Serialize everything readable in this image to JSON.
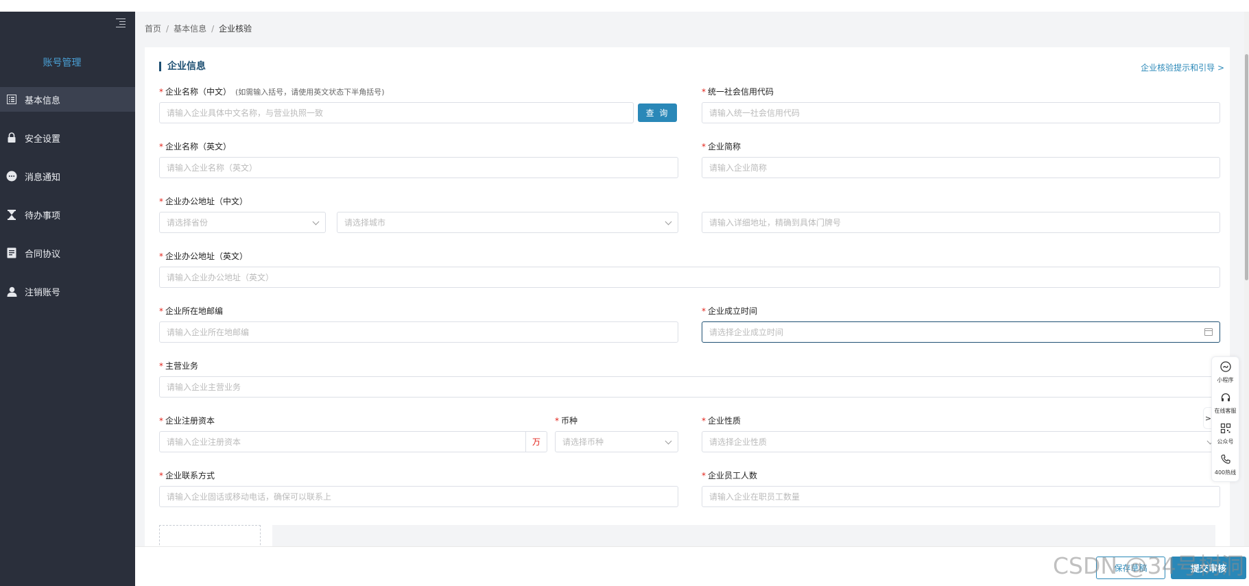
{
  "sidebar": {
    "title": "账号管理",
    "items": [
      {
        "label": "基本信息",
        "icon": "list-icon",
        "active": true
      },
      {
        "label": "安全设置",
        "icon": "lock-icon",
        "active": false
      },
      {
        "label": "消息通知",
        "icon": "message-icon",
        "active": false
      },
      {
        "label": "待办事项",
        "icon": "hourglass-icon",
        "active": false
      },
      {
        "label": "合同协议",
        "icon": "contract-icon",
        "active": false
      },
      {
        "label": "注销账号",
        "icon": "user-icon",
        "active": false
      }
    ]
  },
  "breadcrumb": {
    "home": "首页",
    "parent": "基本信息",
    "current": "企业核验"
  },
  "section": {
    "title": "企业信息",
    "guide_link": "企业核验提示和引导 >"
  },
  "form": {
    "name_cn": {
      "label": "企业名称（中文）",
      "hint": "(如需输入括号，请使用英文状态下半角括号)",
      "placeholder": "请输入企业具体中文名称，与营业执照一致",
      "query_label": "查 询"
    },
    "credit_code": {
      "label": "统一社会信用代码",
      "placeholder": "请输入统一社会信用代码"
    },
    "name_en": {
      "label": "企业名称（英文）",
      "placeholder": "请输入企业名称（英文）"
    },
    "short_name": {
      "label": "企业简称",
      "placeholder": "请输入企业简称"
    },
    "address_cn": {
      "label": "企业办公地址（中文）",
      "province_placeholder": "请选择省份",
      "city_placeholder": "请选择城市",
      "detail_placeholder": "请输入详细地址，精确到具体门牌号"
    },
    "address_en": {
      "label": "企业办公地址（英文）",
      "placeholder": "请输入企业办公地址（英文）"
    },
    "postcode": {
      "label": "企业所在地邮编",
      "placeholder": "请输入企业所在地邮编"
    },
    "founded": {
      "label": "企业成立时间",
      "placeholder": "请选择企业成立时间"
    },
    "business": {
      "label": "主营业务",
      "placeholder": "请输入企业主营业务"
    },
    "capital": {
      "label": "企业注册资本",
      "placeholder": "请输入企业注册资本",
      "unit": "万"
    },
    "currency": {
      "label": "币种",
      "placeholder": "请选择币种"
    },
    "nature": {
      "label": "企业性质",
      "placeholder": "请选择企业性质"
    },
    "contact": {
      "label": "企业联系方式",
      "placeholder": "请输入企业固话或移动电话，确保可以联系上"
    },
    "employees": {
      "label": "企业员工人数",
      "placeholder": "请输入企业在职员工数量"
    }
  },
  "actions": {
    "save_label": "保存草稿",
    "submit_label": "提交审核"
  },
  "float_toolbar": {
    "toggle": ">",
    "items": [
      {
        "label": "小程序",
        "icon": "mini-program-icon"
      },
      {
        "label": "在线客服",
        "icon": "headset-icon"
      },
      {
        "label": "公众号",
        "icon": "qrcode-icon"
      },
      {
        "label": "400热线",
        "icon": "phone-icon"
      }
    ]
  },
  "watermark": "CSDN @34号树洞",
  "colors": {
    "sidebar_bg": "#2a2f3b",
    "accent": "#2a88b8",
    "title_blue": "#1d4f72",
    "required": "#e2231a"
  }
}
